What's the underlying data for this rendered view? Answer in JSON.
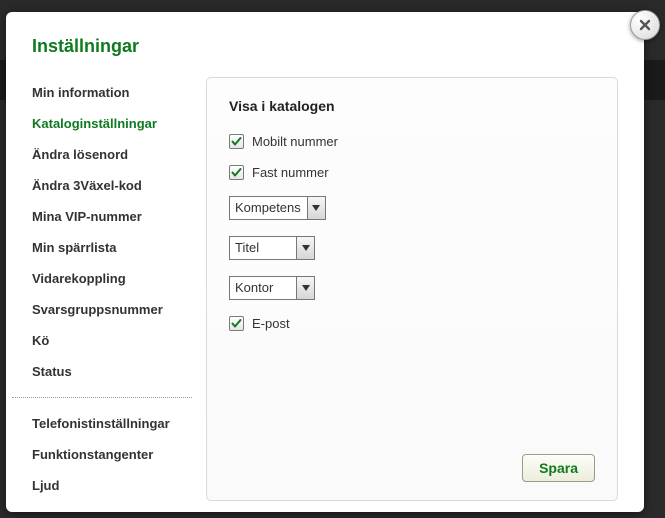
{
  "title": "Inställningar",
  "close_label": "×",
  "sidebar": {
    "items": [
      {
        "label": "Min information"
      },
      {
        "label": "Kataloginställningar"
      },
      {
        "label": "Ändra lösenord"
      },
      {
        "label": "Ändra 3Växel-kod"
      },
      {
        "label": "Mina VIP-nummer"
      },
      {
        "label": "Min spärrlista"
      },
      {
        "label": "Vidarekoppling"
      },
      {
        "label": "Svarsgruppsnummer"
      },
      {
        "label": "Kö"
      },
      {
        "label": "Status"
      }
    ],
    "items2": [
      {
        "label": "Telefonistinställningar"
      },
      {
        "label": "Funktionstangenter"
      },
      {
        "label": "Ljud"
      }
    ]
  },
  "panel": {
    "heading": "Visa i katalogen",
    "mobile_label": "Mobilt nummer",
    "fixed_label": "Fast nummer",
    "select_competence": "Kompetens",
    "select_title": "Titel",
    "select_office": "Kontor",
    "email_label": "E-post",
    "save_label": "Spara"
  }
}
